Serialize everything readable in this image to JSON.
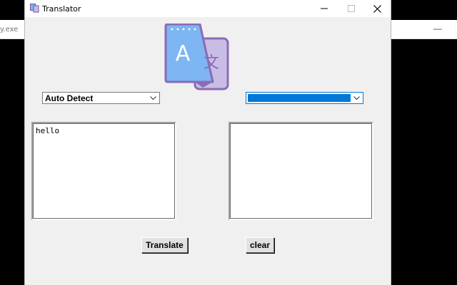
{
  "background_window": {
    "title_fragment": "y.exe"
  },
  "window": {
    "title": "Translator"
  },
  "source_language": {
    "selected": "Auto Detect"
  },
  "target_language": {
    "selected": ""
  },
  "input_box": {
    "text": "hello"
  },
  "output_box": {
    "text": ""
  },
  "buttons": {
    "translate": "Translate",
    "clear": "clear"
  },
  "logo": {
    "letter_latin": "A",
    "letter_cjk": "文"
  },
  "colors": {
    "window_bg": "#f0f0f0",
    "selection": "#0078d7",
    "logo_blue": "#7db6f2",
    "logo_purple": "#c9bde6",
    "logo_stroke": "#8b6bb5"
  }
}
